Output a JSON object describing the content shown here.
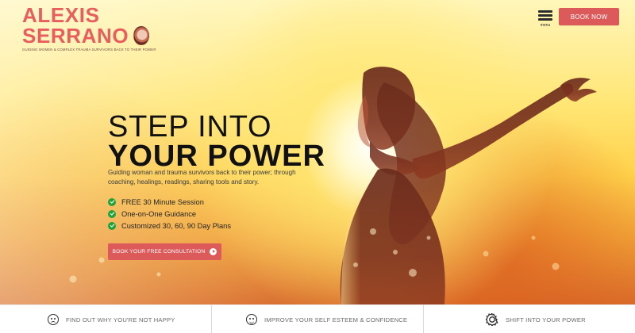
{
  "brand": {
    "name_line1": "ALEXIS",
    "name_line2": "SERRANO",
    "tagline": "GUIDING WOMEN & COMPLEX TRAUMA SURVIVORS BACK TO THEIR POWER"
  },
  "header": {
    "menu_label": "menu",
    "book_now_label": "BOOK NOW"
  },
  "hero": {
    "headline_line1": "STEP INTO",
    "headline_line2": "YOUR POWER",
    "description": "Guiding woman and trauma survivors back to their power; through coaching, healings, readings, sharing tools and story.",
    "benefits": [
      "FREE 30 Minute Session",
      "One-on-One Guidance",
      "Customized 30, 60, 90 Day Plans"
    ],
    "cta_label": "BOOK YOUR FREE CONSULTATION"
  },
  "features": [
    {
      "label": "FIND OUT WHY YOU'RE NOT HAPPY",
      "icon": "sad-face-icon"
    },
    {
      "label": "IMPROVE YOUR SELF ESTEEM & CONFIDENCE",
      "icon": "happy-face-icon"
    },
    {
      "label": "SHIFT INTO YOUR POWER",
      "icon": "gear-icon"
    }
  ],
  "colors": {
    "brand_coral": "#dd5a5a",
    "check_green": "#21a33b",
    "text_dark": "#111111"
  }
}
